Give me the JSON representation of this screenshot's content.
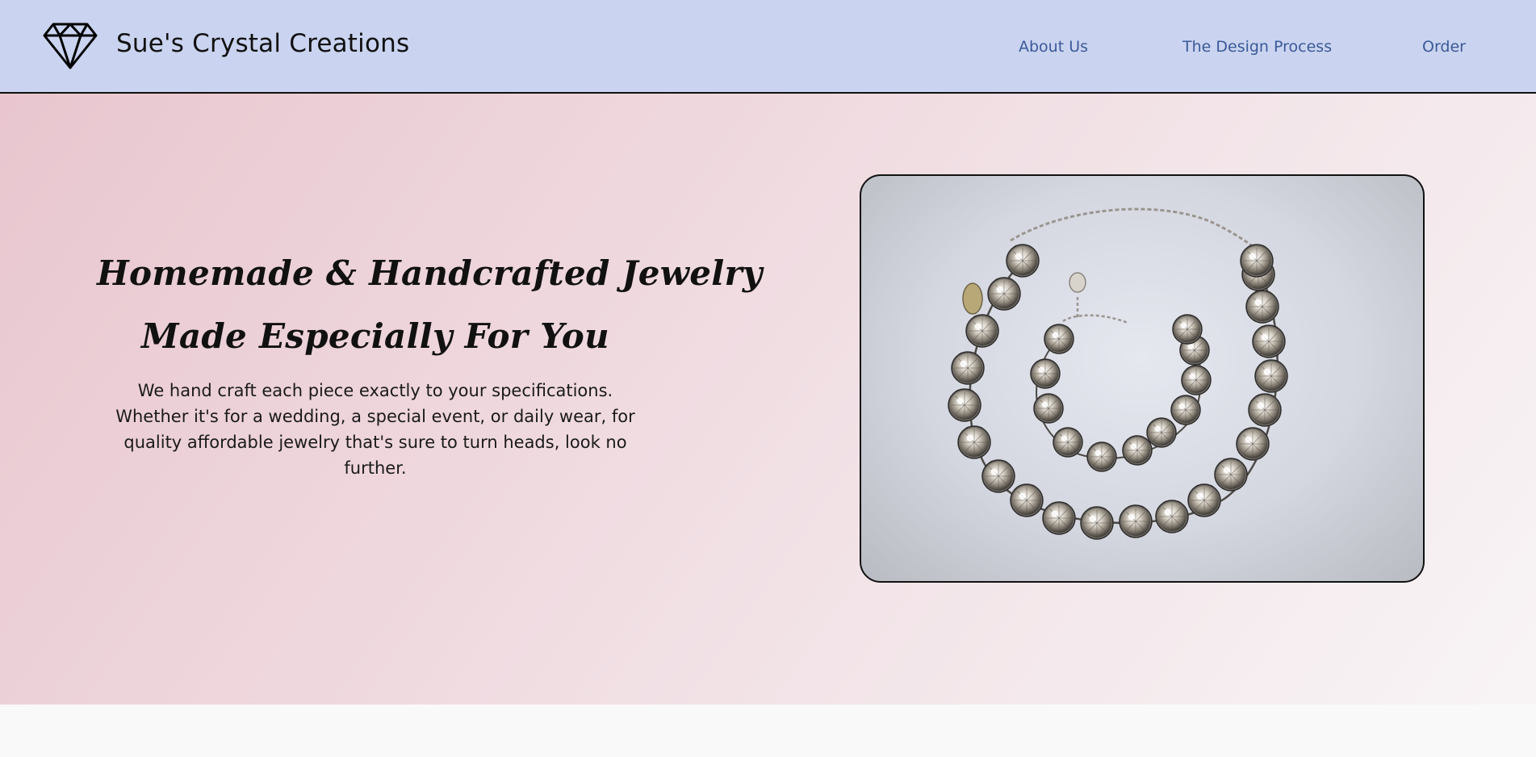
{
  "header": {
    "brand": "Sue's Crystal Creations",
    "logo_icon": "diamond-icon",
    "nav": [
      {
        "label": "About Us"
      },
      {
        "label": "The Design Process"
      },
      {
        "label": "Order"
      }
    ]
  },
  "hero": {
    "headline_line1": "Homemade & Handcrafted Jewelry",
    "headline_line2": "Made Especially For You",
    "description": "We hand craft each piece exactly to your specifications. Whether it's for a wedding, a special event, or daily wear, for quality affordable jewelry that's sure to turn heads, look no further.",
    "image": "crystal-necklace-and-bracelet-photo"
  },
  "colors": {
    "nav_background": "#cad4f0",
    "nav_link": "#3b5998",
    "hero_gradient_start": "#e9c6cf",
    "hero_gradient_end": "#f8f4f6"
  }
}
